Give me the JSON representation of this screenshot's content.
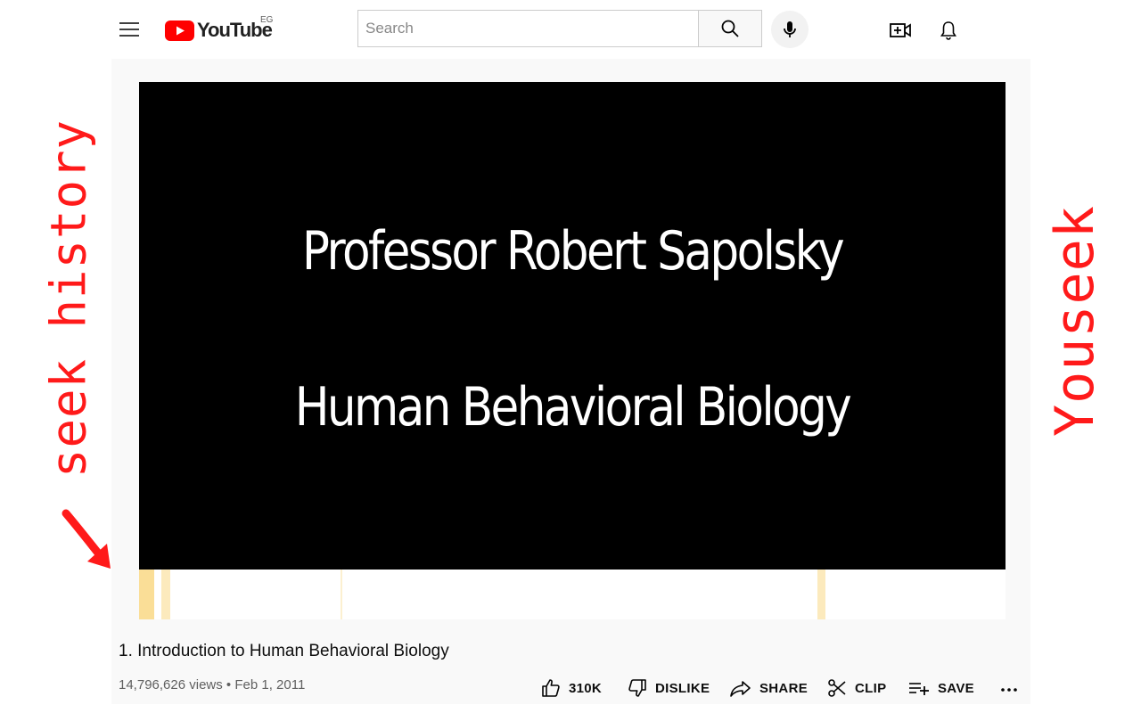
{
  "header": {
    "logo_text": "YouTube",
    "region": "EG",
    "search_placeholder": "Search",
    "icons": [
      "menu-icon",
      "youtube-logo-icon",
      "search-icon",
      "mic-icon",
      "create-video-icon",
      "bell-icon"
    ]
  },
  "player": {
    "line1": "Professor Robert Sapolsky",
    "line2": "Human Behavioral Biology"
  },
  "seek_heatmap": {
    "marks": [
      {
        "position": 0.0,
        "width": 0.017,
        "intensity": 0.55
      },
      {
        "position": 0.026,
        "width": 0.01,
        "intensity": 0.35
      },
      {
        "position": 0.233,
        "width": 0.002,
        "intensity": 0.25
      },
      {
        "position": 0.783,
        "width": 0.009,
        "intensity": 0.35
      }
    ],
    "color": "#f5c242"
  },
  "video": {
    "title": "1. Introduction to Human Behavioral Biology",
    "views": "14,796,626 views",
    "separator": "•",
    "date": "Feb 1, 2011"
  },
  "actions": {
    "like": "310K",
    "dislike": "DISLIKE",
    "share": "SHARE",
    "clip": "CLIP",
    "save": "SAVE"
  },
  "annotations": {
    "left": "seek history",
    "right": "Youseek",
    "color": "#ff1a1a"
  },
  "colors": {
    "brand_red": "#ff0000",
    "panel_bg": "#f9f9f9"
  }
}
